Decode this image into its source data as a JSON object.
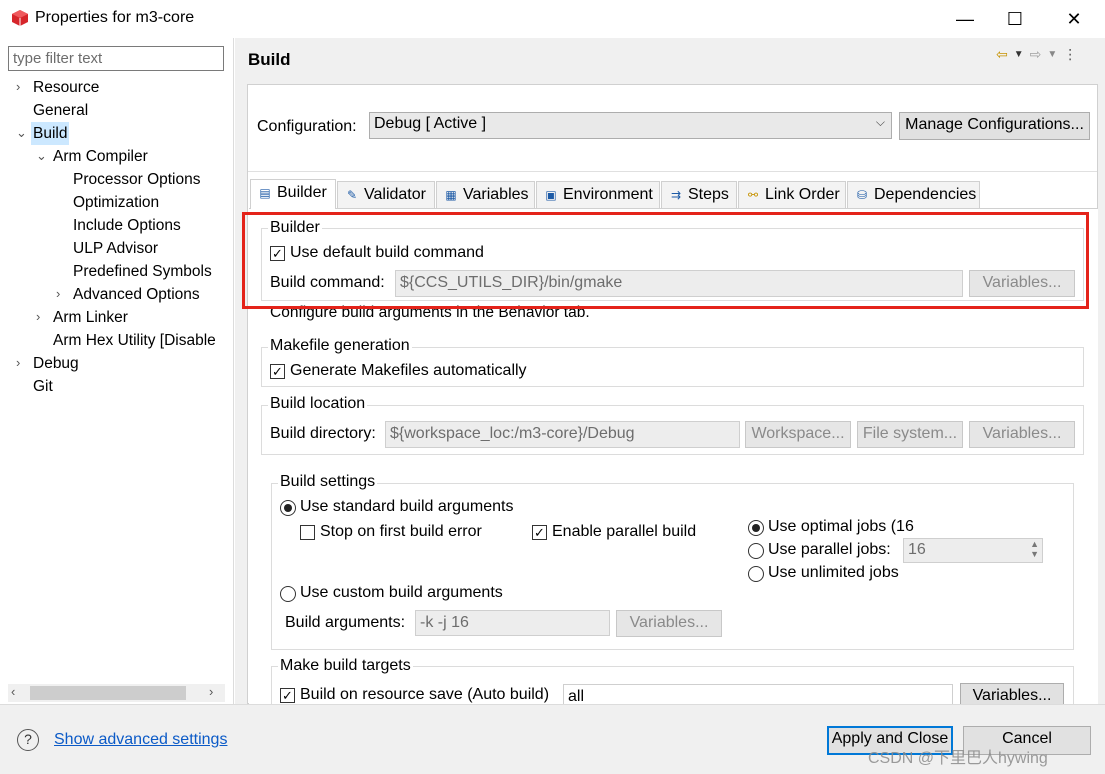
{
  "window": {
    "title": "Properties for m3-core",
    "controls": {
      "minimize": "—",
      "maximize": "☐",
      "close": "✕"
    }
  },
  "filter": {
    "placeholder": "type filter text"
  },
  "tree": {
    "items": [
      {
        "label": "Resource",
        "twisty": "›"
      },
      {
        "label": "General",
        "twisty": ""
      },
      {
        "label": "Build",
        "twisty": "⌄"
      },
      {
        "label": "Arm Compiler",
        "twisty": "⌄"
      },
      {
        "label": "Processor Options",
        "twisty": ""
      },
      {
        "label": "Optimization",
        "twisty": ""
      },
      {
        "label": "Include Options",
        "twisty": ""
      },
      {
        "label": "ULP Advisor",
        "twisty": ""
      },
      {
        "label": "Predefined Symbols",
        "twisty": ""
      },
      {
        "label": "Advanced Options",
        "twisty": "›"
      },
      {
        "label": "Arm Linker",
        "twisty": "›"
      },
      {
        "label": "Arm Hex Utility  [Disable",
        "twisty": ""
      },
      {
        "label": "Debug",
        "twisty": "›"
      },
      {
        "label": "Git",
        "twisty": ""
      }
    ],
    "selected": "Build"
  },
  "page": {
    "title": "Build"
  },
  "configuration": {
    "label": "Configuration:",
    "value": "Debug  [ Active ]",
    "manage_button": "Manage Configurations..."
  },
  "tabs": [
    {
      "label": "Builder",
      "icon": "builder-icon",
      "active": true
    },
    {
      "label": "Validator",
      "icon": "validator-icon",
      "active": false
    },
    {
      "label": "Variables",
      "icon": "variables-icon",
      "active": false
    },
    {
      "label": "Environment",
      "icon": "environment-icon",
      "active": false
    },
    {
      "label": "Steps",
      "icon": "steps-icon",
      "active": false
    },
    {
      "label": "Link Order",
      "icon": "link-order-icon",
      "active": false
    },
    {
      "label": "Dependencies",
      "icon": "dependencies-icon",
      "active": false
    }
  ],
  "builder": {
    "group_title": "Builder",
    "use_default_label": "Use default build command",
    "use_default_checked": true,
    "command_label": "Build command:",
    "command_value": "${CCS_UTILS_DIR}/bin/gmake",
    "variables_button": "Variables...",
    "note": "Configure build arguments in the Behavior tab."
  },
  "makefile": {
    "group_title": "Makefile generation",
    "generate_label": "Generate Makefiles automatically",
    "generate_checked": true
  },
  "location": {
    "group_title": "Build location",
    "directory_label": "Build directory:",
    "directory_value": "${workspace_loc:/m3-core}/Debug",
    "workspace_button": "Workspace...",
    "filesystem_button": "File system...",
    "variables_button": "Variables..."
  },
  "settings": {
    "group_title": "Build settings",
    "standard_label": "Use standard build arguments",
    "stop_first_error_label": "Stop on first build error",
    "stop_first_error_checked": false,
    "parallel_build_label": "Enable parallel build",
    "parallel_build_checked": true,
    "optimal_jobs_label": "Use optimal jobs (16",
    "parallel_jobs_label": "Use parallel jobs:",
    "parallel_jobs_value": "16",
    "unlimited_jobs_label": "Use unlimited jobs",
    "custom_label": "Use custom build arguments",
    "arguments_label": "Build arguments:",
    "arguments_value": "-k -j 16",
    "variables_button": "Variables..."
  },
  "targets": {
    "group_title": "Make build targets",
    "auto_build_label": "Build on resource save (Auto build)",
    "auto_build_value": "all",
    "variables_button": "Variables..."
  },
  "footer": {
    "help_icon_glyph": "?",
    "advanced_link": "Show advanced settings",
    "apply_close_button": "Apply and Close",
    "cancel_button": "Cancel",
    "watermark": "CSDN @下里巴人hywing"
  },
  "colors": {
    "highlight_box": "#e4231a",
    "link": "#0b5ac7",
    "selection": "#cce8ff"
  }
}
